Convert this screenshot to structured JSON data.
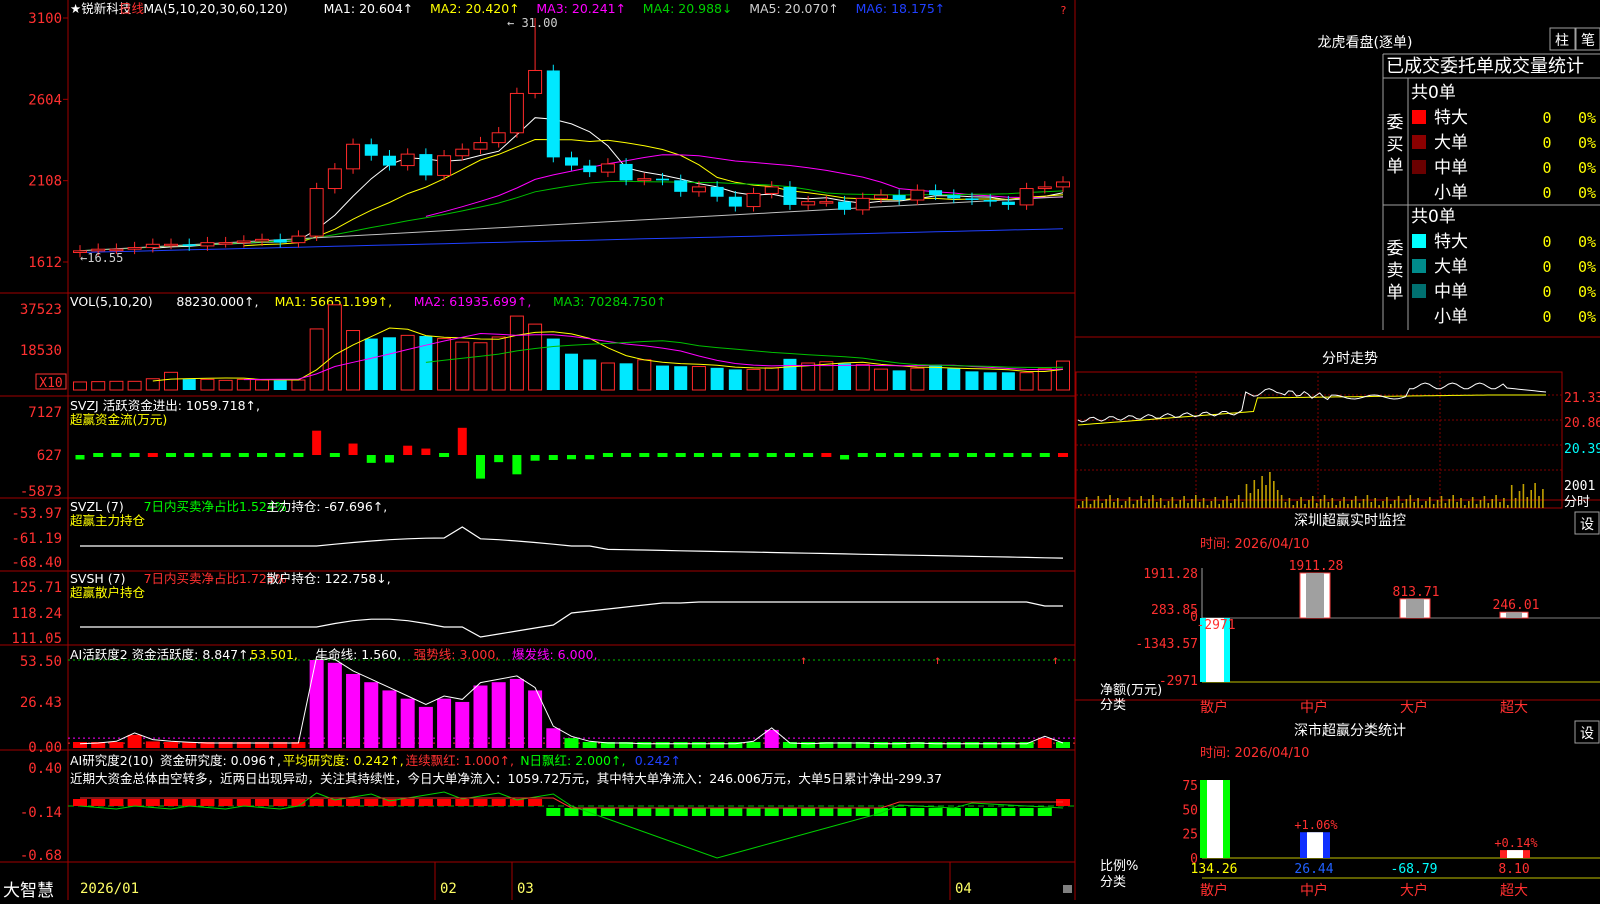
{
  "stock": {
    "name": "锐新科技",
    "period": "日线",
    "star": "★"
  },
  "colors": {
    "up": "#ff2a2a",
    "down": "#00e8ff",
    "ma1": "#ffffff",
    "ma2": "#ffff00",
    "ma3": "#ff00ff",
    "ma4": "#00c000",
    "ma5": "#c0c0c0",
    "ma6": "#2040ff",
    "grid": "#a00000"
  },
  "main": {
    "legend": [
      {
        "text": "★锐新科技",
        "color": "#ffffff"
      },
      {
        "text": "日线",
        "color": "#ff3030"
      },
      {
        "text": "MA(5,10,20,30,60,120)",
        "color": "#ffffff"
      },
      {
        "text": "MA1: 20.604↑",
        "color": "#ffffff"
      },
      {
        "text": "MA2: 20.420↑",
        "color": "#ffff00"
      },
      {
        "text": "MA3: 20.241↑",
        "color": "#ff00ff"
      },
      {
        "text": "MA4: 20.988↓",
        "color": "#00d000"
      },
      {
        "text": "MA5: 20.070↑",
        "color": "#d0d0d0"
      },
      {
        "text": "MA6: 18.175↑",
        "color": "#2040ff"
      }
    ],
    "yticks": [
      "3100",
      "2604",
      "2108",
      "1612"
    ],
    "high_label": "31.00",
    "low_label": "16.55"
  },
  "vol": {
    "legend": [
      {
        "text": "VOL(5,10,20)",
        "color": "#ffffff"
      },
      {
        "text": "88230.000↑,",
        "color": "#ffffff"
      },
      {
        "text": "MA1: 56651.199↑,",
        "color": "#ffff00"
      },
      {
        "text": "MA2: 61935.699↑,",
        "color": "#ff00ff"
      },
      {
        "text": "MA3: 70284.750↑",
        "color": "#00d000"
      }
    ],
    "yticks": [
      "37523",
      "18530"
    ],
    "unit": "X10"
  },
  "svzj": {
    "legend1": [
      {
        "text": "SVZJ  活跃资金进出: 1059.718↑,",
        "color": "#ffffff"
      }
    ],
    "legend2": [
      {
        "text": "超赢资金流(万元)",
        "color": "#ffff00"
      }
    ],
    "yticks": [
      "7127",
      "627",
      "-5873"
    ]
  },
  "svzl": {
    "legend1": [
      {
        "text": "SVZL (7)",
        "color": "#ffffff"
      },
      {
        "text": "7日内买卖净占比1.524%",
        "color": "#00ff00"
      },
      {
        "text": "主力持仓: -67.696↑,",
        "color": "#ffffff"
      }
    ],
    "legend2": [
      {
        "text": "超赢主力持仓",
        "color": "#ffff00"
      }
    ],
    "yticks": [
      "-53.97",
      "-61.19",
      "-68.40"
    ]
  },
  "svsh": {
    "legend1": [
      {
        "text": "SVSH (7)",
        "color": "#ffffff"
      },
      {
        "text": "7日内买卖净占比1.725%",
        "color": "#ff3030"
      },
      {
        "text": "散户持仓: 122.758↓,",
        "color": "#ffffff"
      }
    ],
    "legend2": [
      {
        "text": "超赢散户持仓",
        "color": "#ffff00"
      }
    ],
    "yticks": [
      "125.71",
      "118.24",
      "111.05"
    ]
  },
  "ai2": {
    "legend": [
      {
        "text": "AI活跃度2 资金活跃度: 8.847↑,",
        "color": "#ffffff"
      },
      {
        "text": "53.501,",
        "color": "#ffff00"
      },
      {
        "text": "生命线: 1.560,",
        "color": "#ffffff"
      },
      {
        "text": "强势线: 3.000,",
        "color": "#ff3030"
      },
      {
        "text": "爆发线: 6.000,",
        "color": "#ff00ff"
      }
    ],
    "yticks": [
      "53.50",
      "26.43",
      "0.00"
    ]
  },
  "ai_research": {
    "legend": [
      {
        "text": "AI研究度2(10)",
        "color": "#ffffff"
      },
      {
        "text": "资金研究度: 0.096↑,",
        "color": "#ffffff"
      },
      {
        "text": "平均研究度: 0.242↑,",
        "color": "#ffff00"
      },
      {
        "text": "连续飘红: 1.000↑,",
        "color": "#ff3030"
      },
      {
        "text": "N日飘红: 2.000↑,",
        "color": "#00ff00"
      },
      {
        "text": "0.242↑",
        "color": "#2040ff"
      }
    ],
    "comment": "近期大资金总体由空转多，近两日出现异动，关注其持续性，今日大单净流入：1059.72万元，其中特大单净流入：246.006万元，大单5日累计净出-299.37",
    "yticks": [
      "0.40",
      "-0.14",
      "-0.68"
    ]
  },
  "bottom": {
    "brand": "大智慧",
    "dates": [
      "2026/01",
      "02",
      "03",
      "04"
    ]
  },
  "right": {
    "longhu": {
      "title": "龙虎看盘(逐单)",
      "tab_bar": "柱",
      "tab_stroke": "笔",
      "subtitle": "已成交委托单成交量统计",
      "buy_label": "委买单",
      "sell_label": "委卖单",
      "total": "共0单",
      "rows": [
        {
          "name": "特大",
          "qty": "0",
          "pct": "0%",
          "buy_color": "#ff0000",
          "sell_color": "#00ffff"
        },
        {
          "name": "大单",
          "qty": "0",
          "pct": "0%",
          "buy_color": "#8b0000",
          "sell_color": "#008b8b"
        },
        {
          "name": "中单",
          "qty": "0",
          "pct": "0%",
          "buy_color": "#6a0000",
          "sell_color": "#007070"
        },
        {
          "name": "小单",
          "qty": "0",
          "pct": "0%",
          "buy_color": "",
          "sell_color": ""
        }
      ]
    },
    "intraday": {
      "title": "分时走势",
      "yticks": [
        "21.33",
        "20.86",
        "20.39"
      ],
      "vol_label": "2001",
      "vol_unit": "分时"
    },
    "realtime": {
      "title": "深圳超赢实时监控",
      "set": "设",
      "time": "时间: 2026/04/10",
      "yticks": [
        "1911.28",
        "283.85",
        "0",
        "-1343.57",
        "-2971"
      ],
      "ylabel": "净额(万元)",
      "xlabel": "分类",
      "categories": [
        "散户",
        "中户",
        "大户",
        "超大"
      ],
      "values": [
        -2971,
        1911.28,
        813.71,
        246.01
      ],
      "value_labels": [
        "-2971",
        "1911.28",
        "813.71",
        "246.01"
      ]
    },
    "classify": {
      "title": "深市超赢分类统计",
      "set": "设",
      "time": "时间: 2026/04/10",
      "yticks": [
        "75",
        "50",
        "25",
        "0"
      ],
      "ylabel": "比例%",
      "xlabel": "分类",
      "categories": [
        "散户",
        "中户",
        "大户",
        "超大"
      ],
      "values": [
        134.26,
        26.44,
        -68.79,
        8.1
      ],
      "value_labels": [
        "134.26",
        "26.44",
        "-68.79",
        "8.10"
      ],
      "bar_notes": [
        "",
        "+1.06%",
        "",
        "+0.14%"
      ]
    }
  },
  "chart_data": {
    "type": "candlestick",
    "title": "锐新科技 日线",
    "x_ticks": [
      "2026/01",
      "02",
      "03",
      "04"
    ],
    "ylim": [
      16.12,
      31.0
    ],
    "high": 31.0,
    "low": 16.55,
    "ma_last": {
      "MA1": 20.604,
      "MA2": 20.42,
      "MA3": 20.241,
      "MA4": 20.988,
      "MA5": 20.07,
      "MA6": 18.175
    },
    "close": [
      16.8,
      16.9,
      16.9,
      17.0,
      17.2,
      17.2,
      17.1,
      17.3,
      17.3,
      17.4,
      17.5,
      17.3,
      17.7,
      20.6,
      21.8,
      23.3,
      22.6,
      22.0,
      22.7,
      21.4,
      22.6,
      23.0,
      23.4,
      24.0,
      26.4,
      27.8,
      22.5,
      22.0,
      21.6,
      22.1,
      21.1,
      21.2,
      21.1,
      20.4,
      20.7,
      20.1,
      19.5,
      20.3,
      20.7,
      19.6,
      19.8,
      19.8,
      19.3,
      20.0,
      20.2,
      19.9,
      20.5,
      20.2,
      20.0,
      19.9,
      19.8,
      19.6,
      20.6,
      20.7,
      21.0
    ],
    "volume": [
      2500,
      2600,
      2700,
      2700,
      3500,
      5500,
      3400,
      3300,
      3000,
      3300,
      3100,
      3000,
      3100,
      19000,
      26500,
      18500,
      16000,
      16400,
      17000,
      16800,
      16000,
      14900,
      14700,
      16500,
      23000,
      20500,
      16000,
      11300,
      9500,
      8400,
      8300,
      9400,
      7600,
      7400,
      7300,
      6900,
      6400,
      6400,
      6900,
      9700,
      8400,
      8800,
      8300,
      7900,
      6500,
      6100,
      6800,
      7900,
      6700,
      5800,
      5500,
      5500,
      5400,
      6600,
      9000
    ],
    "fund_flow": [
      -627,
      -188,
      -188,
      -188,
      250,
      -188,
      -188,
      -188,
      -188,
      -188,
      -188,
      -188,
      -188,
      3400,
      -188,
      1600,
      -1100,
      -1050,
      1300,
      900,
      -188,
      3800,
      -3300,
      -1000,
      -2700,
      -800,
      -700,
      -600,
      -600,
      -500,
      -400,
      -400,
      -400,
      -300,
      -300,
      -300,
      -300,
      -300,
      -300,
      -300,
      -300,
      350,
      -627,
      -300,
      -300,
      -300,
      -300,
      -300,
      -300,
      -300,
      -300,
      -300,
      -300,
      -300,
      500
    ],
    "activity": [
      1.5,
      2,
      3,
      8,
      4,
      3,
      2.5,
      2,
      2,
      2,
      2,
      2,
      2,
      53.5,
      51.8,
      45,
      40,
      35,
      30,
      25,
      30,
      28,
      38,
      40,
      42,
      35,
      12,
      6,
      3,
      2,
      2,
      1.5,
      1.5,
      1.5,
      1.5,
      1.5,
      1.5,
      3,
      11,
      2,
      1.5,
      2,
      2,
      2,
      1.5,
      1.5,
      2,
      1.5,
      1.5,
      1.5,
      1.5,
      1.5,
      1.5,
      6,
      2
    ],
    "research": [
      0.1,
      0.1,
      0.09,
      0.1,
      0.09,
      0.09,
      0.1,
      0.09,
      0.1,
      0.09,
      0.09,
      0.1,
      0.09,
      0.2,
      0.1,
      0.12,
      0.11,
      0.1,
      0.1,
      0.1,
      0.09,
      0.1,
      0.09,
      0.09,
      0.09,
      0.07,
      -0.17,
      -0.17,
      -0.17,
      -0.17,
      -0.17,
      -0.17,
      -0.16,
      -0.16,
      -0.16,
      -0.16,
      -0.14,
      -0.14,
      -0.14,
      -0.14,
      -0.14,
      -0.14,
      -0.14,
      -0.14,
      -0.14,
      -0.13,
      -0.13,
      -0.13,
      -0.13,
      -0.13,
      -0.13,
      -0.15,
      -0.14,
      -0.13,
      0.096
    ]
  }
}
